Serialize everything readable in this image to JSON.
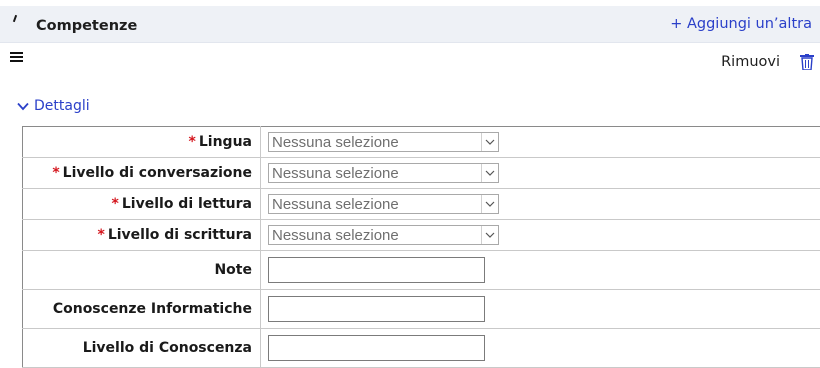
{
  "section": {
    "title": "Competenze",
    "add_link_label": "+ Aggiungi un’altra"
  },
  "item_toolbar": {
    "menu_icon": "hamburger-icon",
    "remove_label": "Rimuovi",
    "remove_icon": "trash-icon"
  },
  "details": {
    "toggle_label": "Dettagli",
    "toggle_icon": "chevron-down-icon"
  },
  "fields": {
    "lingua": {
      "label": "Lingua",
      "required": true,
      "value": "Nessuna selezione"
    },
    "livello_conversazione": {
      "label": "Livello di conversazione",
      "required": true,
      "value": "Nessuna selezione"
    },
    "livello_lettura": {
      "label": "Livello di lettura",
      "required": true,
      "value": "Nessuna selezione"
    },
    "livello_scrittura": {
      "label": "Livello di scrittura",
      "required": true,
      "value": "Nessuna selezione"
    },
    "note": {
      "label": "Note",
      "value": ""
    },
    "conoscenze_informatiche": {
      "label": "Conoscenze Informatiche",
      "value": ""
    },
    "livello_conoscenza": {
      "label": "Livello di Conoscenza",
      "value": ""
    }
  },
  "required_marker": "*",
  "colors": {
    "link": "#2b40c9",
    "required": "#d4141c",
    "header_bg": "#eef1f6"
  }
}
